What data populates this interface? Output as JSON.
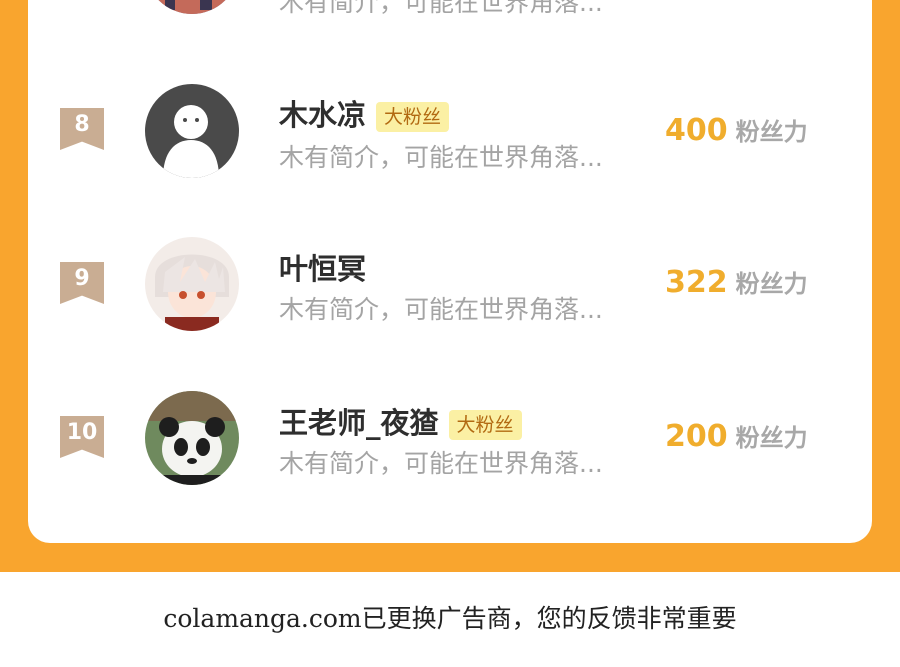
{
  "ranking": {
    "partial_row": {
      "bio": "木有简介，可能在世界角落..."
    },
    "rows": [
      {
        "rank": "8",
        "name": "木水凉",
        "tag": "大粉丝",
        "bio": "木有简介，可能在世界角落...",
        "score": "400",
        "unit": "粉丝力",
        "avatar": "default-silhouette-avatar"
      },
      {
        "rank": "9",
        "name": "叶恒冥",
        "tag": "",
        "bio": "木有简介，可能在世界角落...",
        "score": "322",
        "unit": "粉丝力",
        "avatar": "anime-character-avatar"
      },
      {
        "rank": "10",
        "name": "王老师_夜猹",
        "tag": "大粉丝",
        "bio": "木有简介，可能在世界角落...",
        "score": "200",
        "unit": "粉丝力",
        "avatar": "panda-avatar"
      }
    ]
  },
  "footer": {
    "text": "colamanga.com已更换广告商，您的反馈非常重要"
  },
  "colors": {
    "frame": "#f9a52e",
    "score": "#f0ad2d",
    "badge": "#c9ad93",
    "tag_bg": "#fbf0a4"
  }
}
